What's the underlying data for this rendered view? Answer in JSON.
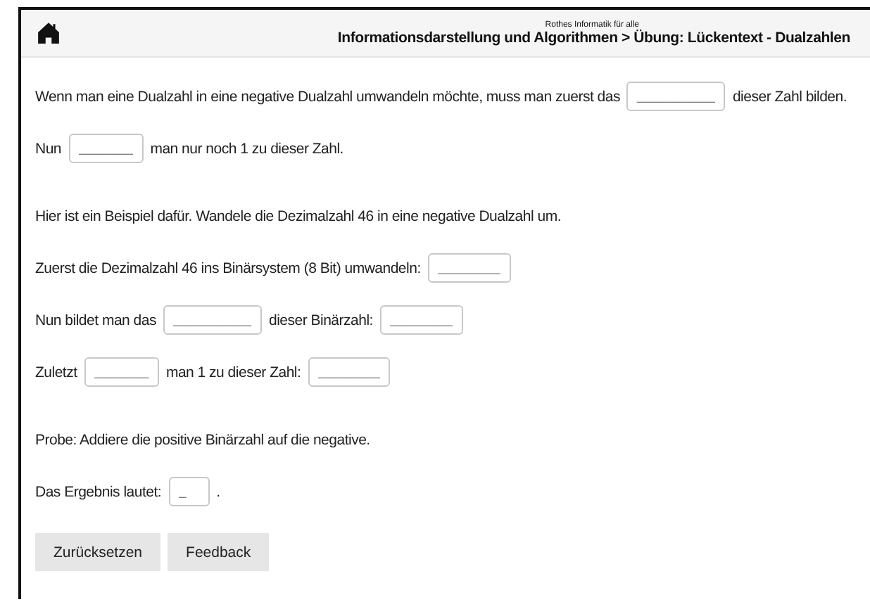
{
  "header": {
    "site": "Rothes Informatik für alle",
    "breadcrumb": "Informationsdarstellung und Algorithmen > Übung: Lückentext - Dualzahlen"
  },
  "sections": [
    [
      [
        {
          "kind": "text",
          "text": "Wenn man eine Dualzahl in eine negative Dualzahl umwandeln möchte, muss man zuerst das"
        },
        {
          "kind": "blank",
          "placeholder": "__________"
        },
        {
          "kind": "text",
          "text": "dieser Zahl bilden."
        }
      ],
      [
        {
          "kind": "text",
          "text": "Nun"
        },
        {
          "kind": "blank",
          "placeholder": "_______"
        },
        {
          "kind": "text",
          "text": "man nur noch 1 zu dieser Zahl."
        }
      ]
    ],
    [
      [
        {
          "kind": "text",
          "text": "Hier ist ein Beispiel dafür. Wandele die Dezimalzahl 46 in eine negative Dualzahl um."
        }
      ],
      [
        {
          "kind": "text",
          "text": "Zuerst die Dezimalzahl 46 ins Binärsystem (8 Bit) umwandeln:"
        },
        {
          "kind": "blank",
          "placeholder": "________"
        }
      ],
      [
        {
          "kind": "text",
          "text": "Nun bildet man das"
        },
        {
          "kind": "blank",
          "placeholder": "__________"
        },
        {
          "kind": "text",
          "text": "dieser Binärzahl:"
        },
        {
          "kind": "blank",
          "placeholder": "________"
        }
      ],
      [
        {
          "kind": "text",
          "text": "Zuletzt"
        },
        {
          "kind": "blank",
          "placeholder": "_______"
        },
        {
          "kind": "text",
          "text": "man 1 zu dieser Zahl:"
        },
        {
          "kind": "blank",
          "placeholder": "________"
        }
      ]
    ],
    [
      [
        {
          "kind": "text",
          "text": "Probe: Addiere die positive Binärzahl auf die negative."
        }
      ],
      [
        {
          "kind": "text",
          "text": "Das Ergebnis lautet:"
        },
        {
          "kind": "blank",
          "placeholder": "_"
        },
        {
          "kind": "text",
          "text": "."
        }
      ]
    ]
  ],
  "buttons": [
    "Zurücksetzen",
    "Feedback"
  ]
}
